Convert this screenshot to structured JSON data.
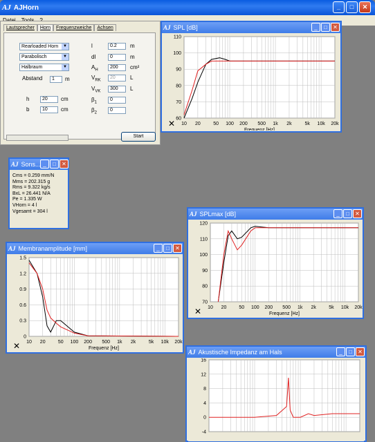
{
  "window": {
    "title": "AJHorn",
    "logo": "AJ"
  },
  "menu": [
    "Datei",
    "Tools",
    "?"
  ],
  "main_panel": {
    "tabs": [
      "Lautsprecher",
      "Horn",
      "Frequenzweiche",
      "Achsen"
    ],
    "selects": [
      "Rearloaded Horn",
      "Parabolisch",
      "Halbraum"
    ],
    "abstand_label": "Abstand",
    "abstand_value": "1",
    "abstand_unit": "m",
    "h_label": "h",
    "h_value": "20",
    "h_unit": "cm",
    "b_label": "b",
    "b_value": "10",
    "b_unit": "cm",
    "params": [
      {
        "label": "l",
        "value": "0.2",
        "unit": "m"
      },
      {
        "label": "dl",
        "value": "0",
        "unit": "m"
      },
      {
        "label": "A",
        "sub": "H",
        "value": "200",
        "unit": "cm²"
      },
      {
        "label": "V",
        "sub": "RK",
        "value": "20",
        "unit": "L"
      },
      {
        "label": "V",
        "sub": "VK",
        "value": "300",
        "unit": "L"
      },
      {
        "label": "β",
        "sub": "1",
        "value": "0",
        "unit": ""
      },
      {
        "label": "β",
        "sub": "2",
        "value": "0",
        "unit": ""
      }
    ],
    "start_label": "Start"
  },
  "sons": {
    "title": "Sons....",
    "lines": [
      "Cms = 0.259 mm/N",
      "Mms = 202.315 g",
      "Rms = 9.322 kg/s",
      "BxL = 26.441 N/A",
      "Pe = 1.335 W",
      "VHorn = 4 l",
      "Vgesamt = 304 l"
    ]
  },
  "spl": {
    "title": "SPL [dB]",
    "xlabel": "Frequenz [Hz]"
  },
  "splmax": {
    "title": "SPLmax [dB]",
    "xlabel": "Frequenz [Hz]"
  },
  "membran": {
    "title": "Membranamplitude [mm]",
    "xlabel": "Frequenz [Hz]"
  },
  "impedanz": {
    "title": "Akustische Impedanz am Hals"
  },
  "chart_data": [
    {
      "type": "line",
      "title": "SPL [dB]",
      "xlabel": "Frequenz [Hz]",
      "xscale": "log",
      "xlim": [
        10,
        20000
      ],
      "ylim": [
        60,
        110
      ],
      "xticks": [
        "10",
        "20",
        "50",
        "100",
        "200",
        "500",
        "1k",
        "2k",
        "5k",
        "10k",
        "20k"
      ],
      "yticks": [
        "60",
        "70",
        "80",
        "90",
        "100",
        "110"
      ],
      "series": [
        {
          "color": "#000000",
          "x": [
            10,
            15,
            20,
            30,
            40,
            60,
            80,
            100,
            200,
            500,
            20000
          ],
          "y": [
            60,
            72,
            82,
            93,
            96,
            97,
            96,
            95,
            95,
            95,
            95
          ]
        },
        {
          "color": "#e02020",
          "x": [
            10,
            15,
            20,
            30,
            40,
            60,
            80,
            100,
            200,
            500,
            20000
          ],
          "y": [
            62,
            77,
            89,
            93,
            95,
            95,
            95,
            95,
            95,
            95,
            95
          ]
        }
      ]
    },
    {
      "type": "line",
      "title": "SPLmax [dB]",
      "xlabel": "Frequenz [Hz]",
      "xscale": "log",
      "xlim": [
        10,
        20000
      ],
      "ylim": [
        70,
        120
      ],
      "xticks": [
        "10",
        "20",
        "50",
        "100",
        "200",
        "500",
        "1k",
        "2k",
        "5k",
        "10k",
        "20k"
      ],
      "yticks": [
        "70",
        "80",
        "90",
        "100",
        "110",
        "120"
      ],
      "series": [
        {
          "color": "#000000",
          "x": [
            15,
            20,
            25,
            30,
            40,
            50,
            80,
            100,
            200,
            20000
          ],
          "y": [
            70,
            95,
            112,
            115,
            110,
            111,
            117,
            118,
            117,
            117
          ]
        },
        {
          "color": "#e02020",
          "x": [
            15,
            20,
            25,
            30,
            40,
            50,
            80,
            100,
            200,
            20000
          ],
          "y": [
            70,
            100,
            115,
            110,
            103,
            106,
            115,
            117,
            117,
            117
          ]
        }
      ]
    },
    {
      "type": "line",
      "title": "Membranamplitude [mm]",
      "xlabel": "Frequenz [Hz]",
      "xscale": "log",
      "xlim": [
        10,
        20000
      ],
      "ylim": [
        0,
        1.5
      ],
      "xticks": [
        "10",
        "20",
        "50",
        "100",
        "200",
        "500",
        "1k",
        "2k",
        "5k",
        "10k",
        "20k"
      ],
      "yticks": [
        "0",
        "0.3",
        "0.6",
        "0.9",
        "1.2",
        "1.5"
      ],
      "series": [
        {
          "color": "#000000",
          "x": [
            10,
            15,
            20,
            25,
            30,
            40,
            50,
            80,
            100,
            200,
            20000
          ],
          "y": [
            1.45,
            1.2,
            0.75,
            0.2,
            0.08,
            0.3,
            0.3,
            0.15,
            0.08,
            0.01,
            0
          ]
        },
        {
          "color": "#e02020",
          "x": [
            10,
            15,
            20,
            25,
            30,
            40,
            50,
            80,
            100,
            200,
            20000
          ],
          "y": [
            1.4,
            1.2,
            0.9,
            0.5,
            0.35,
            0.25,
            0.18,
            0.1,
            0.06,
            0.01,
            0
          ]
        }
      ]
    },
    {
      "type": "line",
      "title": "Akustische Impedanz am Hals",
      "xscale": "log",
      "xlim": [
        10,
        20000
      ],
      "ylim": [
        -4,
        16
      ],
      "yticks": [
        "-4",
        "0",
        "4",
        "8",
        "12",
        "16"
      ],
      "series": [
        {
          "color": "#e02020",
          "x": [
            10,
            100,
            300,
            500,
            550,
            600,
            700,
            1000,
            1500,
            2000,
            5000,
            20000
          ],
          "y": [
            0,
            0,
            0.5,
            3,
            11,
            2,
            0,
            0,
            1,
            0.5,
            1,
            1
          ]
        }
      ]
    }
  ]
}
